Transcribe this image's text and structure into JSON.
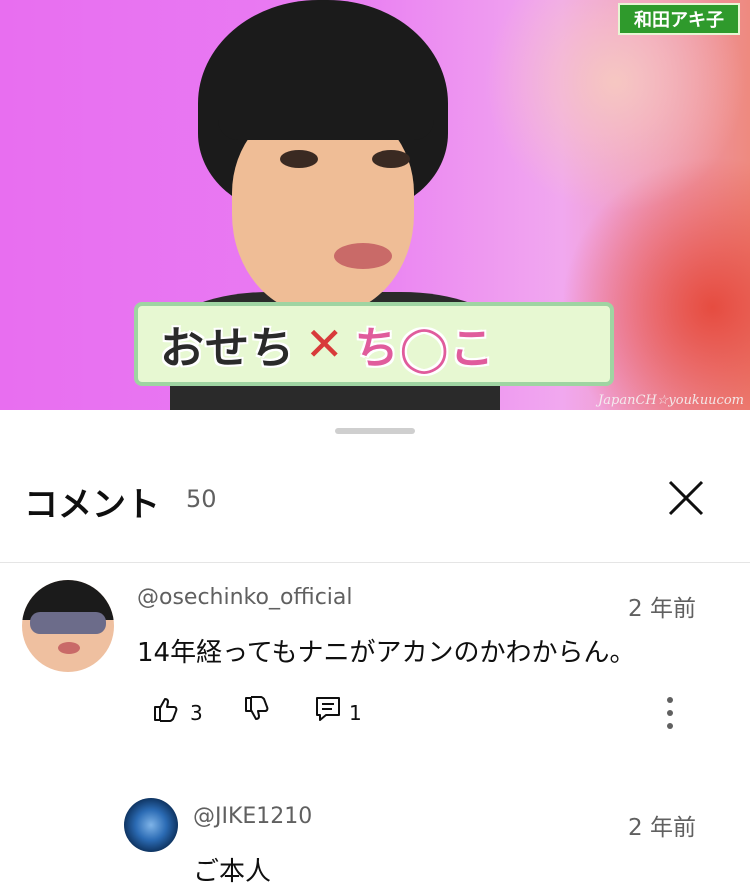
{
  "video": {
    "name_tag": "和田アキ子",
    "caption_left": "おせち",
    "caption_mark": "✕",
    "caption_right": "ち◯こ",
    "watermark": "JapanCH☆youkuucom"
  },
  "comments_panel": {
    "title": "コメント",
    "count": "50",
    "close_icon": "close-icon"
  },
  "comments": [
    {
      "author": "@osechinko_official",
      "time": "2 年前",
      "text": "14年経ってもナニがアカンのかわからん。",
      "likes": "3",
      "replies": "1"
    }
  ],
  "replies": [
    {
      "author": "@JIKE1210",
      "time": "2 年前",
      "text": "ご本人"
    }
  ]
}
